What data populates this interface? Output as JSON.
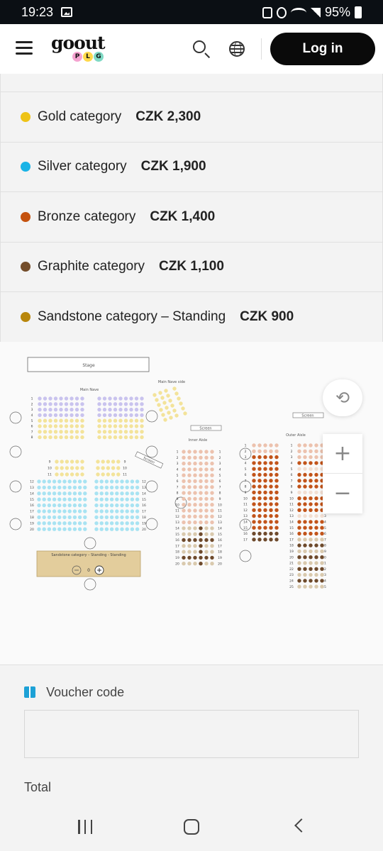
{
  "status_bar": {
    "time": "19:23",
    "battery": "95%"
  },
  "header": {
    "logo_text": "goout",
    "logo_sub": [
      "P",
      "L",
      "G"
    ],
    "login_label": "Log in"
  },
  "categories": [
    {
      "name": "Gold category",
      "price": "CZK 2,300",
      "color": "#eec316"
    },
    {
      "name": "Silver category",
      "price": "CZK 1,900",
      "color": "#19b3e6"
    },
    {
      "name": "Bronze category",
      "price": "CZK 1,400",
      "color": "#c5520e"
    },
    {
      "name": "Graphite category",
      "price": "CZK 1,100",
      "color": "#734d2a"
    },
    {
      "name": "Sandstone category – Standing",
      "price": "CZK 900",
      "color": "#b8860b"
    }
  ],
  "seat_map": {
    "stage_label": "Stage",
    "main_nave_label": "Main Nave",
    "main_nave_side_label": "Main Nave side",
    "screen_label": "Screen",
    "inner_aisle_label": "Inner Aisle",
    "outer_aisle_label": "Outer Aisle",
    "standing_label": "Sandstone category – Standing - Standing",
    "standing_qty": "0"
  },
  "voucher": {
    "label": "Voucher code",
    "placeholder": ""
  },
  "total_label": "Total"
}
